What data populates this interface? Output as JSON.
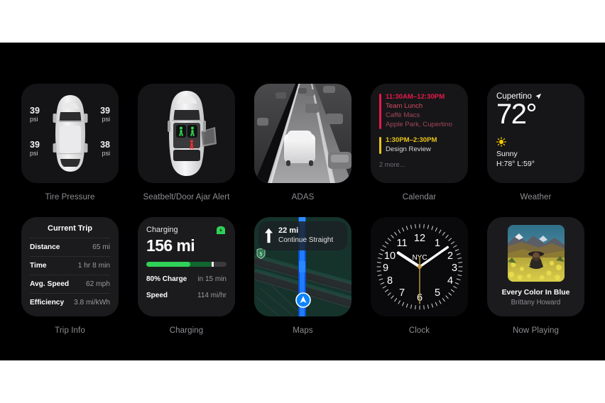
{
  "theme": {
    "page_background": "#ffffff",
    "panel_background": "#000000",
    "card_background": "#1b1b1d",
    "caption_color": "#8e8e93",
    "accent_green": "#30d158",
    "accent_red": "#ff375f",
    "accent_yellow": "#ffd60a",
    "accent_blue": "#0a84ff"
  },
  "widgets": {
    "tire_pressure": {
      "caption": "Tire Pressure",
      "icon": "car-top-view-icon",
      "tires": [
        {
          "position": "front-left",
          "value": "39",
          "unit": "psi"
        },
        {
          "position": "front-right",
          "value": "39",
          "unit": "psi"
        },
        {
          "position": "rear-left",
          "value": "39",
          "unit": "psi"
        },
        {
          "position": "rear-right",
          "value": "38",
          "unit": "psi"
        }
      ]
    },
    "seatbelt": {
      "caption": "Seatbelt/Door Ajar Alert",
      "icon": "car-interior-top-view-icon",
      "seats": [
        {
          "position": "front-left",
          "status": "buckled",
          "color": "#30d158"
        },
        {
          "position": "front-right",
          "status": "buckled",
          "color": "#30d158"
        },
        {
          "position": "rear-center",
          "status": "unbuckled",
          "color": "#ff3b30"
        }
      ],
      "door_ajar": "rear-right"
    },
    "adas": {
      "caption": "ADAS",
      "icon": "road-driving-visualization-icon"
    },
    "calendar": {
      "caption": "Calendar",
      "events": [
        {
          "time": "11:30AM–12:30PM",
          "title": "Team Lunch",
          "location": "Caffè Macs",
          "address": "Apple Park, Cupertino",
          "color": "#e8194b"
        },
        {
          "time": "1:30PM–2:30PM",
          "title": "Design Review",
          "location": "",
          "address": "",
          "color": "#e8c31a"
        }
      ],
      "more_label": "2 more..."
    },
    "weather": {
      "caption": "Weather",
      "city": "Cupertino",
      "location_icon": "location-arrow-icon",
      "temperature": "72°",
      "condition_icon": "sun-icon",
      "condition": "Sunny",
      "high_low": "H:78° L:59°"
    },
    "trip_info": {
      "caption": "Trip Info",
      "title": "Current Trip",
      "rows": [
        {
          "label": "Distance",
          "value": "65 mi"
        },
        {
          "label": "Time",
          "value": "1 hr 8 min"
        },
        {
          "label": "Avg. Speed",
          "value": "62 mph"
        },
        {
          "label": "Efficiency",
          "value": "3.8 mi/kWh"
        }
      ]
    },
    "charging": {
      "caption": "Charging",
      "status_label": "Charging",
      "status_icon": "battery-charging-icon",
      "range": "156 mi",
      "progress_percent": 55,
      "target_percent": 80,
      "rows": [
        {
          "label": "80% Charge",
          "value": "in 15 min"
        },
        {
          "label": "Speed",
          "value": "114 mi/hr"
        }
      ]
    },
    "maps": {
      "caption": "Maps",
      "maneuver_icon": "arrow-up-icon",
      "distance": "22 mi",
      "instruction": "Continue Straight",
      "location_puck_icon": "navigation-puck-icon",
      "route_shield": "5"
    },
    "clock": {
      "caption": "Clock",
      "city": "NYC",
      "numerals": [
        "1",
        "2",
        "3",
        "4",
        "5",
        "6",
        "7",
        "8",
        "9",
        "10",
        "11",
        "12"
      ],
      "hour_hand_deg": 303,
      "minute_hand_deg": 55,
      "second_hand_deg": 180
    },
    "now_playing": {
      "caption": "Now Playing",
      "artwork_icon": "album-artwork-icon",
      "track_title": "Every Color In Blue",
      "artist": "Brittany Howard"
    }
  }
}
